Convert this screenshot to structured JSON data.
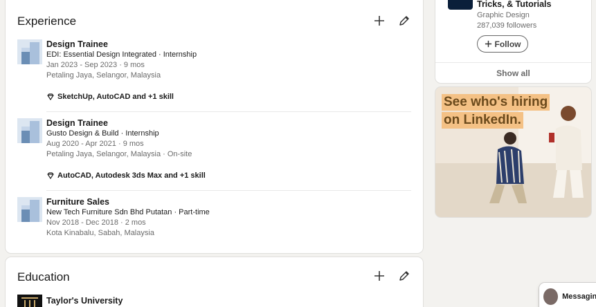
{
  "experience": {
    "title": "Experience",
    "items": [
      {
        "role": "Design Trainee",
        "company": "EDI: Essential Design Integrated · Internship",
        "dates": "Jan 2023 - Sep 2023 · 9 mos",
        "location": "Petaling Jaya, Selangor, Malaysia",
        "skills": "SketchUp, AutoCAD and +1 skill"
      },
      {
        "role": "Design Trainee",
        "company": "Gusto Design & Build · Internship",
        "dates": "Aug 2020 - Apr 2021 · 9 mos",
        "location": "Petaling Jaya, Selangor, Malaysia · On-site",
        "skills": "AutoCAD, Autodesk 3ds Max and +1 skill"
      },
      {
        "role": "Furniture Sales",
        "company": "New Tech Furniture Sdn Bhd Putatan · Part-time",
        "dates": "Nov 2018 - Dec 2018 · 2 mos",
        "location": "Kota Kinabalu, Sabah, Malaysia"
      }
    ]
  },
  "education": {
    "title": "Education",
    "items": [
      {
        "school": "Taylor's University"
      }
    ]
  },
  "follow_card": {
    "title": "Tricks, & Tutorials",
    "category": "Graphic Design",
    "followers": "287,039 followers",
    "follow_label": "Follow",
    "show_all": "Show all"
  },
  "ad": {
    "line1": "See who's hiring",
    "line2": "on LinkedIn."
  },
  "messaging": {
    "label": "Messaging"
  },
  "colors": {
    "page_bg": "#f3f2ef",
    "ad_highlight": "#f4c185",
    "ad_text": "#6b4a1c"
  }
}
